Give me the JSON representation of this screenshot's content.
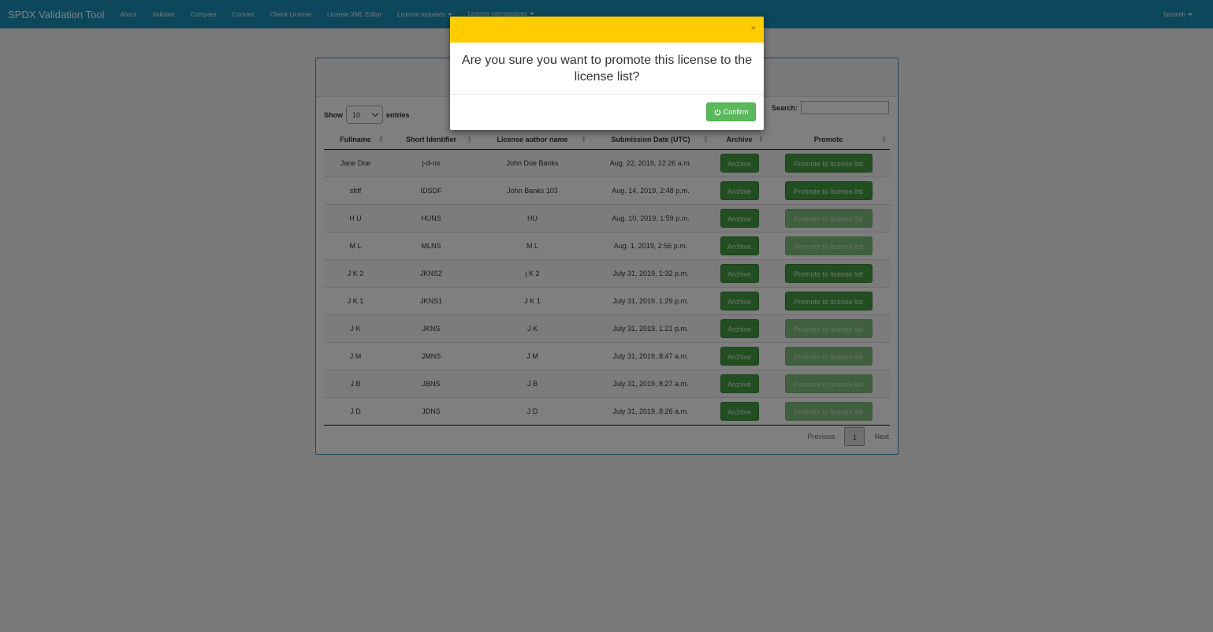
{
  "navbar": {
    "brand": "SPDX Validation Tool",
    "items": [
      {
        "label": "About"
      },
      {
        "label": "Validate"
      },
      {
        "label": "Compare"
      },
      {
        "label": "Convert"
      },
      {
        "label": "Check License"
      },
      {
        "label": "License XML Editor"
      },
      {
        "label": "License requests"
      },
      {
        "label": "License namespaces"
      }
    ],
    "user": "tjasmith",
    "bar_color": "#1a8fb8"
  },
  "table_controls": {
    "show_label": "Show",
    "entries_value": "10",
    "entries_label": "entries",
    "search_label": "Search:",
    "search_value": ""
  },
  "table": {
    "headers": [
      "Fullname",
      "Short Identifier",
      "License author name",
      "Submission Date (UTC)",
      "Archive",
      "Promote"
    ],
    "archive_label": "Archive",
    "promote_label": "Promote to license list",
    "rows": [
      {
        "fullname": "Jane Doe",
        "short_id": "j-d-ns",
        "author": "John Doe Banks",
        "date": "Aug. 22, 2019, 12:26 a.m.",
        "promote_enabled": true
      },
      {
        "fullname": "sfdf",
        "short_id": "IDSDF",
        "author": "John Banks 103",
        "date": "Aug. 14, 2019, 2:48 p.m.",
        "promote_enabled": true
      },
      {
        "fullname": "H U",
        "short_id": "HUNS",
        "author": "HU",
        "date": "Aug. 10, 2019, 1:59 p.m.",
        "promote_enabled": false
      },
      {
        "fullname": "M L",
        "short_id": "MLNS",
        "author": "M L",
        "date": "Aug. 1, 2019, 2:56 p.m.",
        "promote_enabled": false
      },
      {
        "fullname": "J K 2",
        "short_id": "JKNS2",
        "author": "j K 2",
        "date": "July 31, 2019, 1:32 p.m.",
        "promote_enabled": true
      },
      {
        "fullname": "J K 1",
        "short_id": "JKNS1",
        "author": "J K 1",
        "date": "July 31, 2019, 1:29 p.m.",
        "promote_enabled": true
      },
      {
        "fullname": "J K",
        "short_id": "JKNS",
        "author": "J K",
        "date": "July 31, 2019, 1:21 p.m.",
        "promote_enabled": false
      },
      {
        "fullname": "J M",
        "short_id": "JMNS",
        "author": "J M",
        "date": "July 31, 2019, 8:47 a.m.",
        "promote_enabled": false
      },
      {
        "fullname": "J B",
        "short_id": "JBNS",
        "author": "J B",
        "date": "July 31, 2019, 8:27 a.m.",
        "promote_enabled": false
      },
      {
        "fullname": "J D",
        "short_id": "JDNS",
        "author": "J D",
        "date": "July 31, 2019, 8:26 a.m.",
        "promote_enabled": false
      }
    ]
  },
  "pagination": {
    "previous": "Previous",
    "current_page": "1",
    "next": "Next"
  },
  "modal": {
    "close_symbol": "×",
    "message": "Are you sure you want to promote this license to the license list?",
    "confirm_label": "Confirm",
    "confirm_icon": "power-icon",
    "header_color": "#ffcc00",
    "confirm_color": "#5cb85c"
  }
}
